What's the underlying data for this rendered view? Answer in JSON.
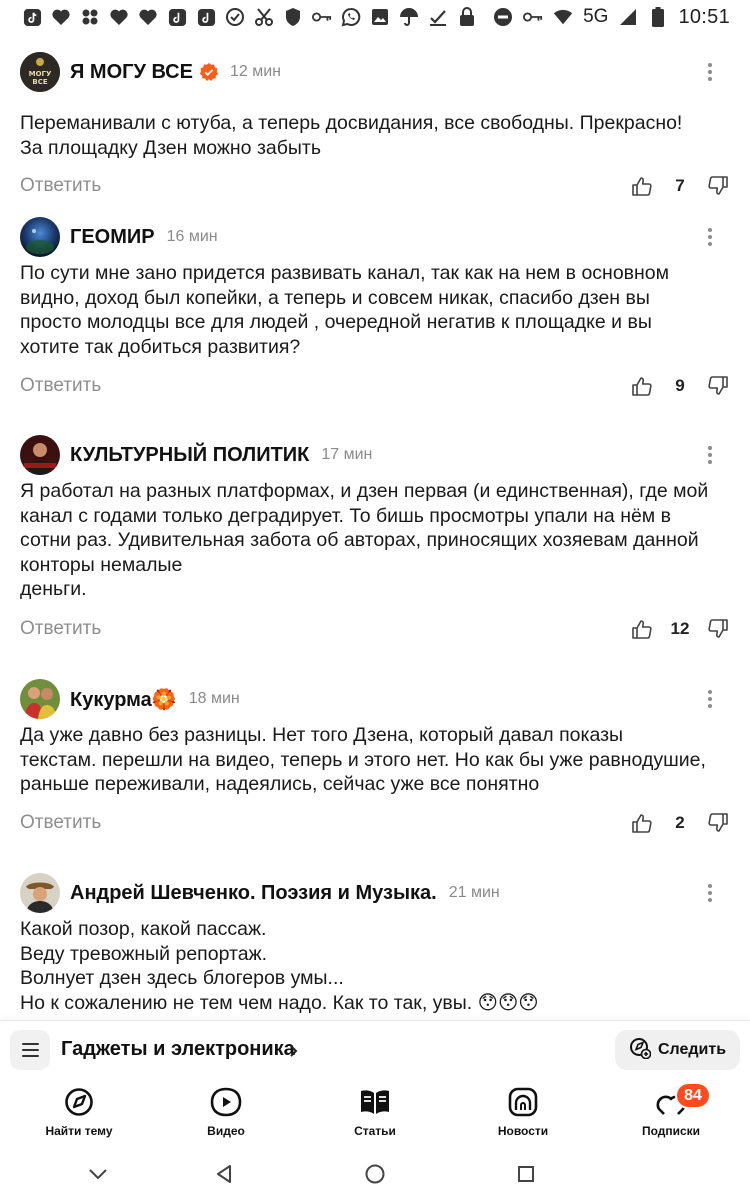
{
  "status_bar": {
    "icons": [
      "tiktok-icon",
      "heart-icon",
      "grid-icon",
      "heart-icon",
      "heart-icon",
      "tiktok-icon",
      "tiktok-icon",
      "check-circle-icon",
      "scissors-icon",
      "shield-icon",
      "key-icon",
      "whatsapp-icon",
      "image-icon",
      "umbrella-icon",
      "checkmark-icon",
      "lock-icon"
    ],
    "network": "5G",
    "time": "10:51"
  },
  "comments": [
    {
      "author": "Я МОГУ ВСЕ",
      "verified": true,
      "time": "12 мин",
      "text": "Переманивали с ютуба, а теперь досвидания, все свободны. Прекрасно!\nЗа площадку Дзен можно забыть",
      "reply_label": "Ответить",
      "likes": "7"
    },
    {
      "author": "ГЕОМИР",
      "verified": false,
      "time": "16 мин",
      "text": "По сути мне зано придется развивать канал, так как на нем в основном\nвидно, доход был копейки, а теперь и совсем никак, спасибо дзен вы\nпросто молодцы все для людей , очередной негатив к площадке и вы\nхотите так добиться развития?",
      "reply_label": "Ответить",
      "likes": "9"
    },
    {
      "author": "КУЛЬТУРНЫЙ ПОЛИТИК",
      "verified": false,
      "time": "17 мин",
      "text": "Я работал на разных платформах, и дзен первая (и единственная), где мой\nканал с годами только деградирует. То бишь просмотры упали на нём в\nсотни раз. Удивительная забота об авторах, приносящих хозяевам данной\nконторы немалые\nденьги.",
      "reply_label": "Ответить",
      "likes": "12"
    },
    {
      "author": "Кукурма🏵️",
      "verified": false,
      "time": "18 мин",
      "text": "Да уже давно без разницы. Нет того Дзена, который давал показы\nтекстам. перешли на видео, теперь и этого нет. Но как бы уже равнодушие,\nраньше переживали, надеялись, сейчас уже все понятно",
      "reply_label": "Ответить",
      "likes": "2"
    },
    {
      "author": "Андрей Шевченко. Поэзия и Музыка.",
      "verified": false,
      "time": "21 мин",
      "text": "Какой позор, какой пассаж.\nВеду тревожный репортаж.\nВолнует дзен здесь блогеров умы...\nНо к сожалению не тем чем надо. Как то так, увы. 😯😯😯",
      "reply_label": "",
      "likes": ""
    }
  ],
  "topic_bar": {
    "title": "Гаджеты и электроника",
    "follow_label": "Следить"
  },
  "bottom_nav": {
    "items": [
      {
        "label": "Найти тему",
        "icon": "compass-icon"
      },
      {
        "label": "Видео",
        "icon": "video-icon"
      },
      {
        "label": "Статьи",
        "icon": "articles-icon"
      },
      {
        "label": "Новости",
        "icon": "news-icon"
      },
      {
        "label": "Подписки",
        "icon": "subscriptions-icon",
        "badge": "84"
      }
    ]
  },
  "colors": {
    "verified": "#ff5b1a",
    "badge": "#ff4b1e",
    "muted_text": "#8e8e8e"
  }
}
